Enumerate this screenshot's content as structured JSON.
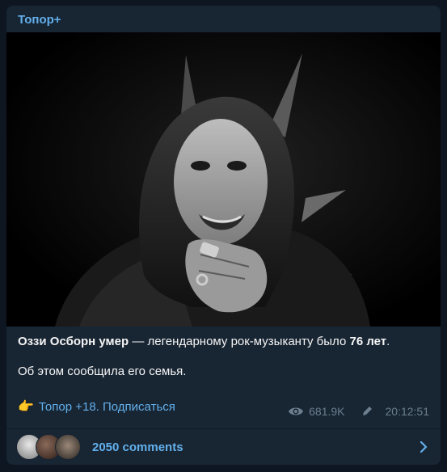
{
  "channel": {
    "name": "Топор+"
  },
  "post": {
    "text_bold_1": "Оззи Осборн умер",
    "text_mid": " — легендарному рок-музыканту было ",
    "text_bold_2": "76 лет",
    "text_end": ".",
    "text_line2": "Об этом сообщила его семья.",
    "promo_link": "Топор +18. Подписаться",
    "promo_icon": "pointing-hand-icon"
  },
  "meta": {
    "views": "681.9K",
    "time": "20:12:51",
    "views_icon": "eye-icon",
    "edited_icon": "pencil-icon"
  },
  "comments": {
    "label": "2050 comments",
    "icon": "chevron-right-icon"
  },
  "colors": {
    "background": "#0e1621",
    "card": "#182533",
    "accent": "#62b0ec",
    "muted": "#6d7f8f",
    "text": "#f5f5f5"
  }
}
